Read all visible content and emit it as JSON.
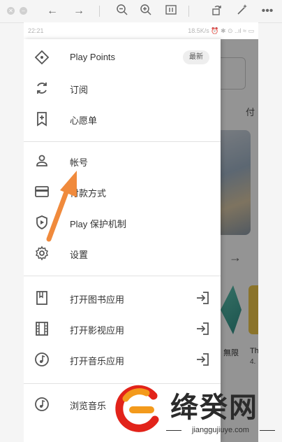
{
  "viewer": {
    "icons": [
      "close-dot",
      "minimize-dot",
      "back-arrow",
      "forward-arrow",
      "zoom-out",
      "zoom-in",
      "fit-screen",
      "rotate",
      "enhance",
      "more"
    ]
  },
  "status": {
    "time": "22:21",
    "right": "18.5K/s ⏰ ✱ ⊙ ..ıl ≈ ▭"
  },
  "background": {
    "tab_label": "付",
    "thumb_label_1": "無限",
    "thumb_label_2": "Th",
    "thumb_rating": "4."
  },
  "drawer": {
    "items": [
      {
        "label": "Play Points",
        "badge": "最新",
        "icon": "diamond-icon"
      },
      {
        "label": "订阅",
        "icon": "refresh-icon"
      },
      {
        "label": "心愿单",
        "icon": "bookmark-add-icon"
      },
      {
        "label": "帐号",
        "icon": "person-icon"
      },
      {
        "label": "付款方式",
        "icon": "credit-card-icon"
      },
      {
        "label": "Play 保护机制",
        "icon": "shield-play-icon"
      },
      {
        "label": "设置",
        "icon": "gear-icon"
      },
      {
        "label": "打开图书应用",
        "icon": "book-icon",
        "trail": "open-app-icon"
      },
      {
        "label": "打开影视应用",
        "icon": "film-icon",
        "trail": "open-app-icon"
      },
      {
        "label": "打开音乐应用",
        "icon": "music-icon",
        "trail": "open-app-icon"
      },
      {
        "label": "浏览音乐",
        "icon": "music-icon"
      }
    ]
  },
  "watermark": {
    "brand": "绛癸网",
    "url": "jianggujiuye.com"
  },
  "colors": {
    "arrow": "#f08a3c",
    "scrim": "rgba(0,0,0,0.42)",
    "logo_orange": "#f39a1c",
    "logo_red": "#e2231a"
  }
}
